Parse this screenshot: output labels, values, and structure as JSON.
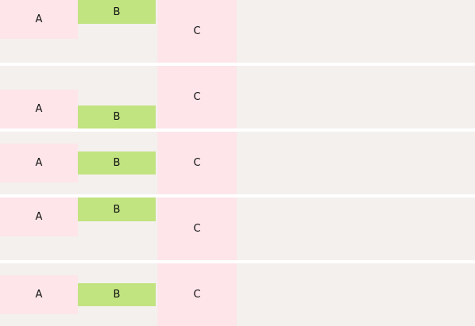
{
  "rows": [
    {
      "a": "A",
      "b": "B",
      "c": "C"
    },
    {
      "a": "A",
      "b": "B",
      "c": "C"
    },
    {
      "a": "A",
      "b": "B",
      "c": "C"
    },
    {
      "a": "A",
      "b": "B",
      "c": "C"
    },
    {
      "a": "A",
      "b": "B",
      "c": "C"
    }
  ],
  "colors": {
    "row_background": "#f4f0ed",
    "box_a": "#fde5e9",
    "box_b": "#c1e380",
    "box_c": "#fde5e9",
    "separator": "#ffffff"
  }
}
